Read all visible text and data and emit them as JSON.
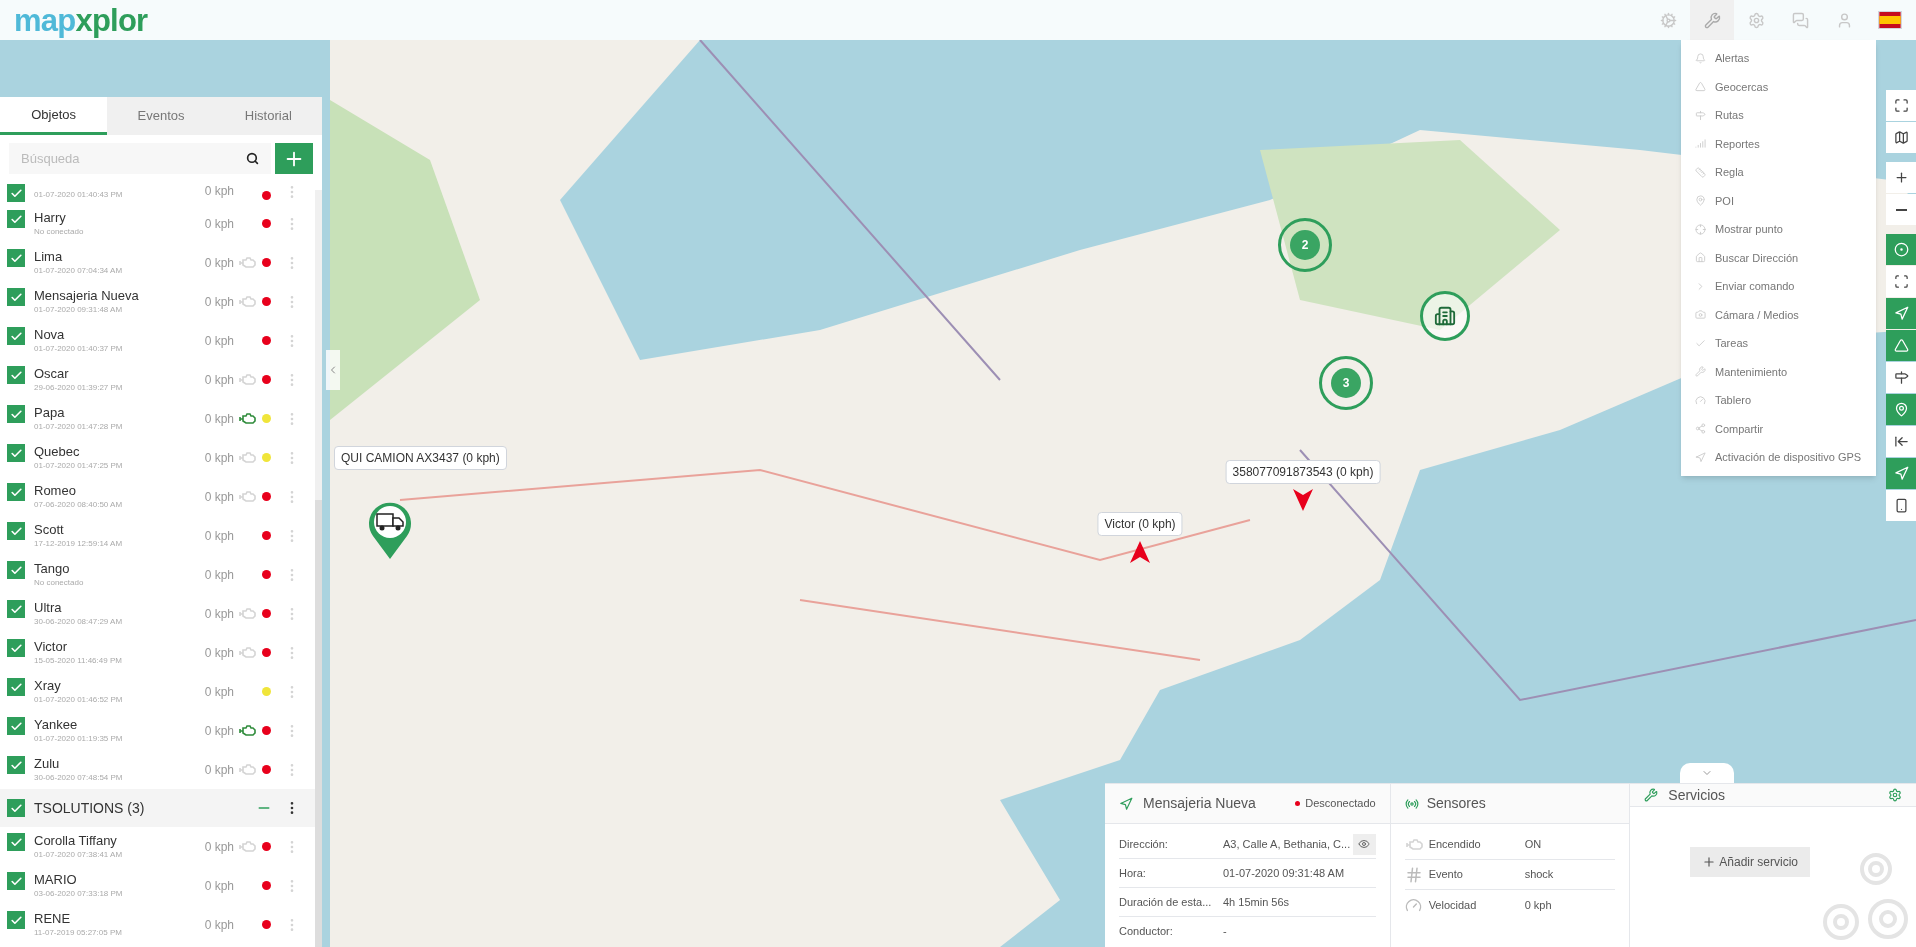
{
  "header": {
    "logo": {
      "first": "map",
      "second": "xplor"
    },
    "toolbar": [
      {
        "kind": "objects",
        "selected": false
      },
      {
        "kind": "tools",
        "selected": true
      },
      {
        "kind": "settings",
        "selected": false
      },
      {
        "kind": "chat",
        "selected": false
      },
      {
        "kind": "user",
        "selected": false
      }
    ]
  },
  "sidebar": {
    "tabs": [
      {
        "label": "Objetos",
        "selected": true
      },
      {
        "label": "Eventos",
        "selected": false
      },
      {
        "label": "Historial",
        "selected": false
      }
    ],
    "search": {
      "placeholder": "Búsqueda"
    },
    "items": [
      {
        "kind": "object",
        "checked": true,
        "subtitle": "01-07-2020 01:40:43 PM",
        "speed": "0 kph",
        "color": "#e8001c"
      },
      {
        "kind": "object",
        "checked": true,
        "name": "Harry",
        "subtitle": "No conectado",
        "speed": "0 kph",
        "color": "#e8001c"
      },
      {
        "kind": "object",
        "checked": true,
        "name": "Lima",
        "subtitle": "01-07-2020 07:04:34 AM",
        "speed": "0 kph",
        "engine_on": false,
        "color": "#e8001c"
      },
      {
        "kind": "object",
        "checked": true,
        "name": "Mensajeria Nueva",
        "subtitle": "01-07-2020 09:31:48 AM",
        "speed": "0 kph",
        "engine_on": false,
        "color": "#e8001c"
      },
      {
        "kind": "object",
        "checked": true,
        "name": "Nova",
        "subtitle": "01-07-2020 01:40:37 PM",
        "speed": "0 kph",
        "color": "#e8001c"
      },
      {
        "kind": "object",
        "checked": true,
        "name": "Oscar",
        "subtitle": "29-06-2020 01:39:27 PM",
        "speed": "0 kph",
        "engine_on": false,
        "color": "#e8001c"
      },
      {
        "kind": "object",
        "checked": true,
        "name": "Papa",
        "subtitle": "01-07-2020 01:47:28 PM",
        "speed": "0 kph",
        "engine_on": true,
        "color": "#f0e53a"
      },
      {
        "kind": "object",
        "checked": true,
        "name": "Quebec",
        "subtitle": "01-07-2020 01:47:25 PM",
        "speed": "0 kph",
        "engine_on": false,
        "color": "#f0e53a"
      },
      {
        "kind": "object",
        "checked": true,
        "name": "Romeo",
        "subtitle": "07-06-2020 08:40:50 AM",
        "speed": "0 kph",
        "engine_on": false,
        "color": "#e8001c"
      },
      {
        "kind": "object",
        "checked": true,
        "name": "Scott",
        "subtitle": "17-12-2019 12:59:14 AM",
        "speed": "0 kph",
        "color": "#e8001c"
      },
      {
        "kind": "object",
        "checked": true,
        "name": "Tango",
        "subtitle": "No conectado",
        "speed": "0 kph",
        "color": "#e8001c"
      },
      {
        "kind": "object",
        "checked": true,
        "name": "Ultra",
        "subtitle": "30-06-2020 08:47:29 AM",
        "speed": "0 kph",
        "engine_on": false,
        "color": "#e8001c"
      },
      {
        "kind": "object",
        "checked": true,
        "name": "Victor",
        "subtitle": "15-05-2020 11:46:49 PM",
        "speed": "0 kph",
        "engine_on": false,
        "color": "#e8001c"
      },
      {
        "kind": "object",
        "checked": true,
        "name": "Xray",
        "subtitle": "01-07-2020 01:46:52 PM",
        "speed": "0 kph",
        "color": "#f0e53a"
      },
      {
        "kind": "object",
        "checked": true,
        "name": "Yankee",
        "subtitle": "01-07-2020 01:19:35 PM",
        "speed": "0 kph",
        "engine_on": true,
        "color": "#e8001c"
      },
      {
        "kind": "object",
        "checked": true,
        "name": "Zulu",
        "subtitle": "30-06-2020 07:48:54 PM",
        "speed": "0 kph",
        "engine_on": false,
        "color": "#e8001c"
      },
      {
        "kind": "group",
        "checked": true,
        "expanded": true,
        "name": "TSOLUTIONS (3)"
      },
      {
        "kind": "object",
        "checked": true,
        "name": "Corolla Tiffany",
        "subtitle": "01-07-2020 07:38:41 AM",
        "speed": "0 kph",
        "engine_on": false,
        "color": "#e8001c"
      },
      {
        "kind": "object",
        "checked": true,
        "name": "MARIO",
        "subtitle": "03-06-2020 07:33:18 PM",
        "speed": "0 kph",
        "color": "#e8001c"
      },
      {
        "kind": "object",
        "checked": true,
        "name": "RENE",
        "subtitle": "11-07-2019 05:27:05 PM",
        "speed": "0 kph",
        "color": "#e8001c"
      }
    ]
  },
  "tools_menu": {
    "items": [
      {
        "label": "Alertas"
      },
      {
        "label": "Geocercas"
      },
      {
        "label": "Rutas"
      },
      {
        "label": "Reportes"
      },
      {
        "label": "Regla"
      },
      {
        "label": "POI"
      },
      {
        "label": "Mostrar punto"
      },
      {
        "label": "Buscar Dirección"
      },
      {
        "label": "Enviar comando"
      },
      {
        "label": "Cámara / Medios"
      },
      {
        "label": "Tareas"
      },
      {
        "label": "Mantenimiento"
      },
      {
        "label": "Tablero"
      },
      {
        "label": "Compartir"
      },
      {
        "label": "Activación de dispositivo GPS"
      }
    ]
  },
  "map_controls": [
    {
      "kind": "fullscreen",
      "on": false
    },
    {
      "kind": "layers",
      "on": false
    },
    {
      "kind": "zoom_in",
      "on": false
    },
    {
      "kind": "zoom_out",
      "on": false
    },
    {
      "kind": "clusters",
      "on": true
    },
    {
      "kind": "fit",
      "on": false
    },
    {
      "kind": "follow",
      "on": true
    },
    {
      "kind": "geofences",
      "on": true
    },
    {
      "kind": "routes",
      "on": false
    },
    {
      "kind": "poi",
      "on": true
    },
    {
      "kind": "history",
      "on": false
    },
    {
      "kind": "send",
      "on": true
    },
    {
      "kind": "device",
      "on": false
    }
  ],
  "map_markers": [
    {
      "kind": "cluster",
      "count": "2"
    },
    {
      "kind": "cluster",
      "count": "3"
    },
    {
      "kind": "building"
    },
    {
      "kind": "truck",
      "label": "QUI CAMION AX3437 (0 kph)"
    },
    {
      "kind": "arrow",
      "label": "Victor (0 kph)"
    },
    {
      "kind": "arrow",
      "label": "358077091873543 (0 kph)"
    }
  ],
  "details": {
    "object": {
      "title": "Mensajeria Nueva",
      "status": "Desconectado",
      "color": "#e8001c",
      "rows": [
        {
          "label": "Dirección:",
          "value": "A3, Calle A, Bethania, C...",
          "has_view": true
        },
        {
          "label": "Hora:",
          "value": "01-07-2020 09:31:48 AM"
        },
        {
          "label": "Duración de esta...",
          "value": "4h 15min 56s"
        },
        {
          "label": "Conductor:",
          "value": "-"
        }
      ]
    },
    "sensors": {
      "title": "Sensores",
      "rows": [
        {
          "kind": "engine",
          "label": "Encendido",
          "value": "ON"
        },
        {
          "kind": "event",
          "label": "Evento",
          "value": "shock"
        },
        {
          "kind": "speed",
          "label": "Velocidad",
          "value": "0 kph"
        }
      ]
    },
    "services": {
      "title": "Servicios",
      "button": "Añadir servicio"
    }
  }
}
